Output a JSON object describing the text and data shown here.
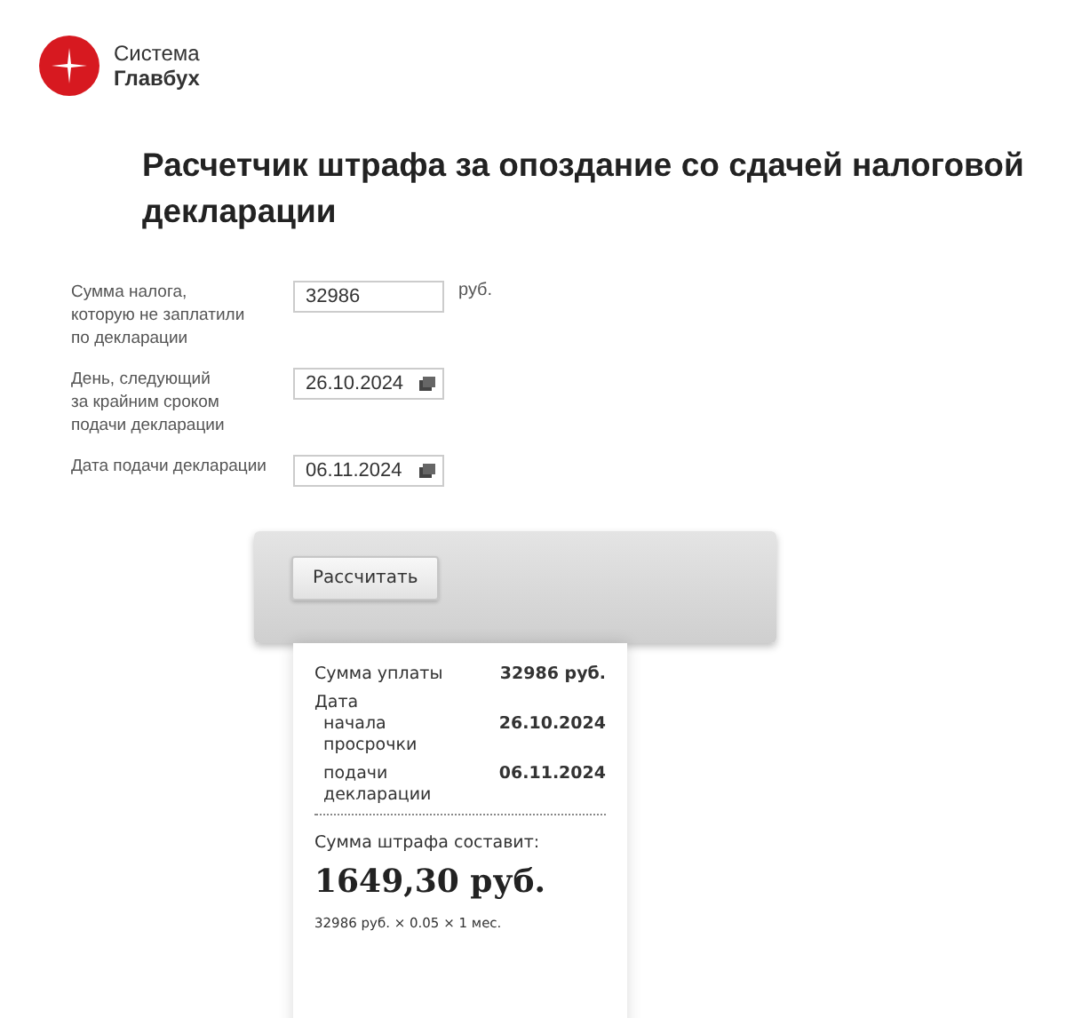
{
  "logo": {
    "line1": "Система",
    "line2": "Главбух"
  },
  "title": "Расчетчик штрафа за опоздание со сдачей налоговой декларации",
  "fields": [
    {
      "kind": "text",
      "label": "Сумма налога,\nкоторую не заплатили\nпо декларации",
      "value": "32986",
      "unit": "руб."
    },
    {
      "kind": "date",
      "label": "День, следующий\nза крайним сроком\nподачи декларации",
      "value": "26.10.2024"
    },
    {
      "kind": "date",
      "label": "Дата подачи декларации",
      "value": "06.11.2024"
    }
  ],
  "button": "Рассчитать",
  "receipt": {
    "sum_label": "Сумма уплаты",
    "sum_value": "32986 руб.",
    "date_label": "Дата",
    "dates": [
      {
        "label": "начала\nпросрочки",
        "value": "26.10.2024"
      },
      {
        "label": "подачи\nдекларации",
        "value": "06.11.2024"
      }
    ],
    "fine_label": "Сумма штрафа составит:",
    "fine_value": "1649,30 руб.",
    "formula": "32986 руб. × 0.05 × 1 мес."
  }
}
